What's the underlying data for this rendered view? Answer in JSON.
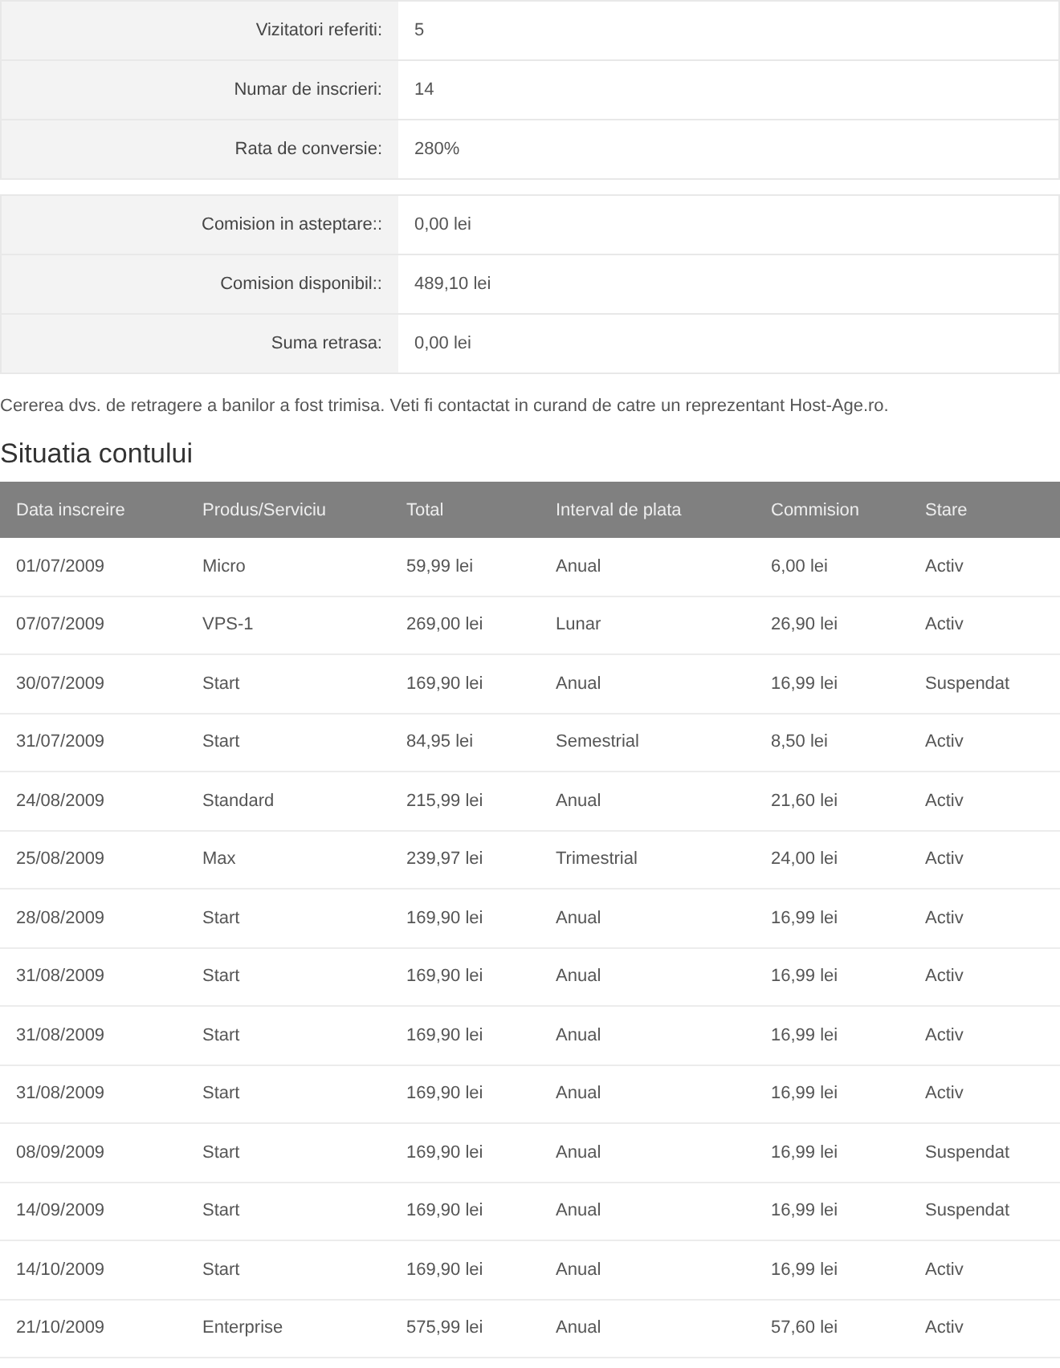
{
  "stats": [
    {
      "label": "Vizitatori referiti:",
      "value": "5"
    },
    {
      "label": "Numar de inscrieri:",
      "value": "14"
    },
    {
      "label": "Rata de conversie:",
      "value": "280%"
    }
  ],
  "commission": [
    {
      "label": "Comision in asteptare::",
      "value": "0,00 lei"
    },
    {
      "label": "Comision disponibil::",
      "value": "489,10 lei"
    },
    {
      "label": "Suma retrasa:",
      "value": "0,00 lei"
    }
  ],
  "message": "Cererea dvs. de retragere a banilor a fost trimisa. Veti fi contactat in curand de catre un reprezentant Host-Age.ro.",
  "section_title": "Situatia contului",
  "table": {
    "columns": [
      "Data inscreire",
      "Produs/Serviciu",
      "Total",
      "Interval de plata",
      "Commision",
      "Stare"
    ],
    "rows": [
      [
        "01/07/2009",
        "Micro",
        "59,99 lei",
        "Anual",
        "6,00 lei",
        "Activ"
      ],
      [
        "07/07/2009",
        "VPS-1",
        "269,00 lei",
        "Lunar",
        "26,90 lei",
        "Activ"
      ],
      [
        "30/07/2009",
        "Start",
        "169,90 lei",
        "Anual",
        "16,99 lei",
        "Suspendat"
      ],
      [
        "31/07/2009",
        "Start",
        "84,95 lei",
        "Semestrial",
        "8,50 lei",
        "Activ"
      ],
      [
        "24/08/2009",
        "Standard",
        "215,99 lei",
        "Anual",
        "21,60 lei",
        "Activ"
      ],
      [
        "25/08/2009",
        "Max",
        "239,97 lei",
        "Trimestrial",
        "24,00 lei",
        "Activ"
      ],
      [
        "28/08/2009",
        "Start",
        "169,90 lei",
        "Anual",
        "16,99 lei",
        "Activ"
      ],
      [
        "31/08/2009",
        "Start",
        "169,90 lei",
        "Anual",
        "16,99 lei",
        "Activ"
      ],
      [
        "31/08/2009",
        "Start",
        "169,90 lei",
        "Anual",
        "16,99 lei",
        "Activ"
      ],
      [
        "31/08/2009",
        "Start",
        "169,90 lei",
        "Anual",
        "16,99 lei",
        "Activ"
      ],
      [
        "08/09/2009",
        "Start",
        "169,90 lei",
        "Anual",
        "16,99 lei",
        "Suspendat"
      ],
      [
        "14/09/2009",
        "Start",
        "169,90 lei",
        "Anual",
        "16,99 lei",
        "Suspendat"
      ],
      [
        "14/10/2009",
        "Start",
        "169,90 lei",
        "Anual",
        "16,99 lei",
        "Activ"
      ],
      [
        "21/10/2009",
        "Enterprise",
        "575,99 lei",
        "Anual",
        "57,60 lei",
        "Activ"
      ]
    ]
  }
}
